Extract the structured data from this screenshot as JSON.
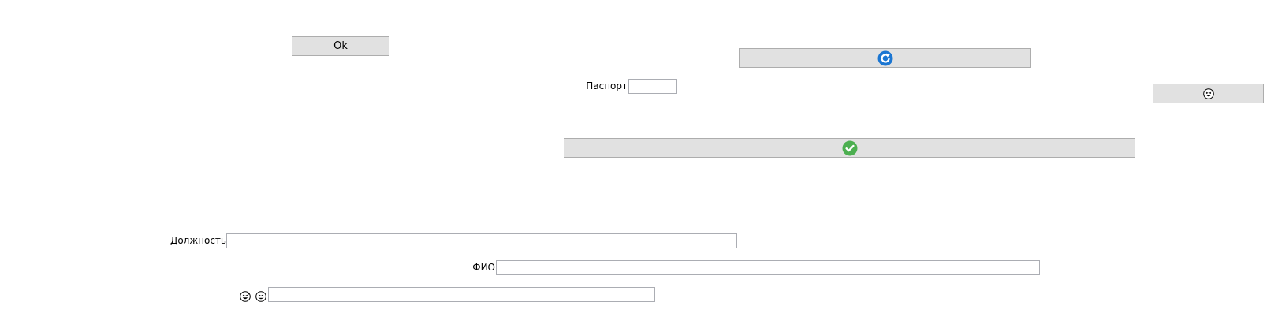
{
  "buttons": {
    "ok_label": "Ok",
    "refresh_icon": "refresh-arrow-icon",
    "emoji_icon": "grinning-sweat-face-icon",
    "confirm_icon": "green-check-circle-icon"
  },
  "fields": {
    "passport_label": "Паспорт",
    "passport_value": "",
    "position_label": "Должность",
    "position_value": "",
    "fio_label": "ФИО",
    "fio_value": "",
    "emoji_field_value": ""
  },
  "emoji_label": {
    "first_icon": "grinning-sweat-face-icon",
    "second_icon": "grinning-squint-face-icon"
  },
  "colors": {
    "refresh_blue": "#1b76d2",
    "check_green": "#4caf50",
    "button_bg": "#e1e1e1",
    "button_border": "#adadad"
  }
}
